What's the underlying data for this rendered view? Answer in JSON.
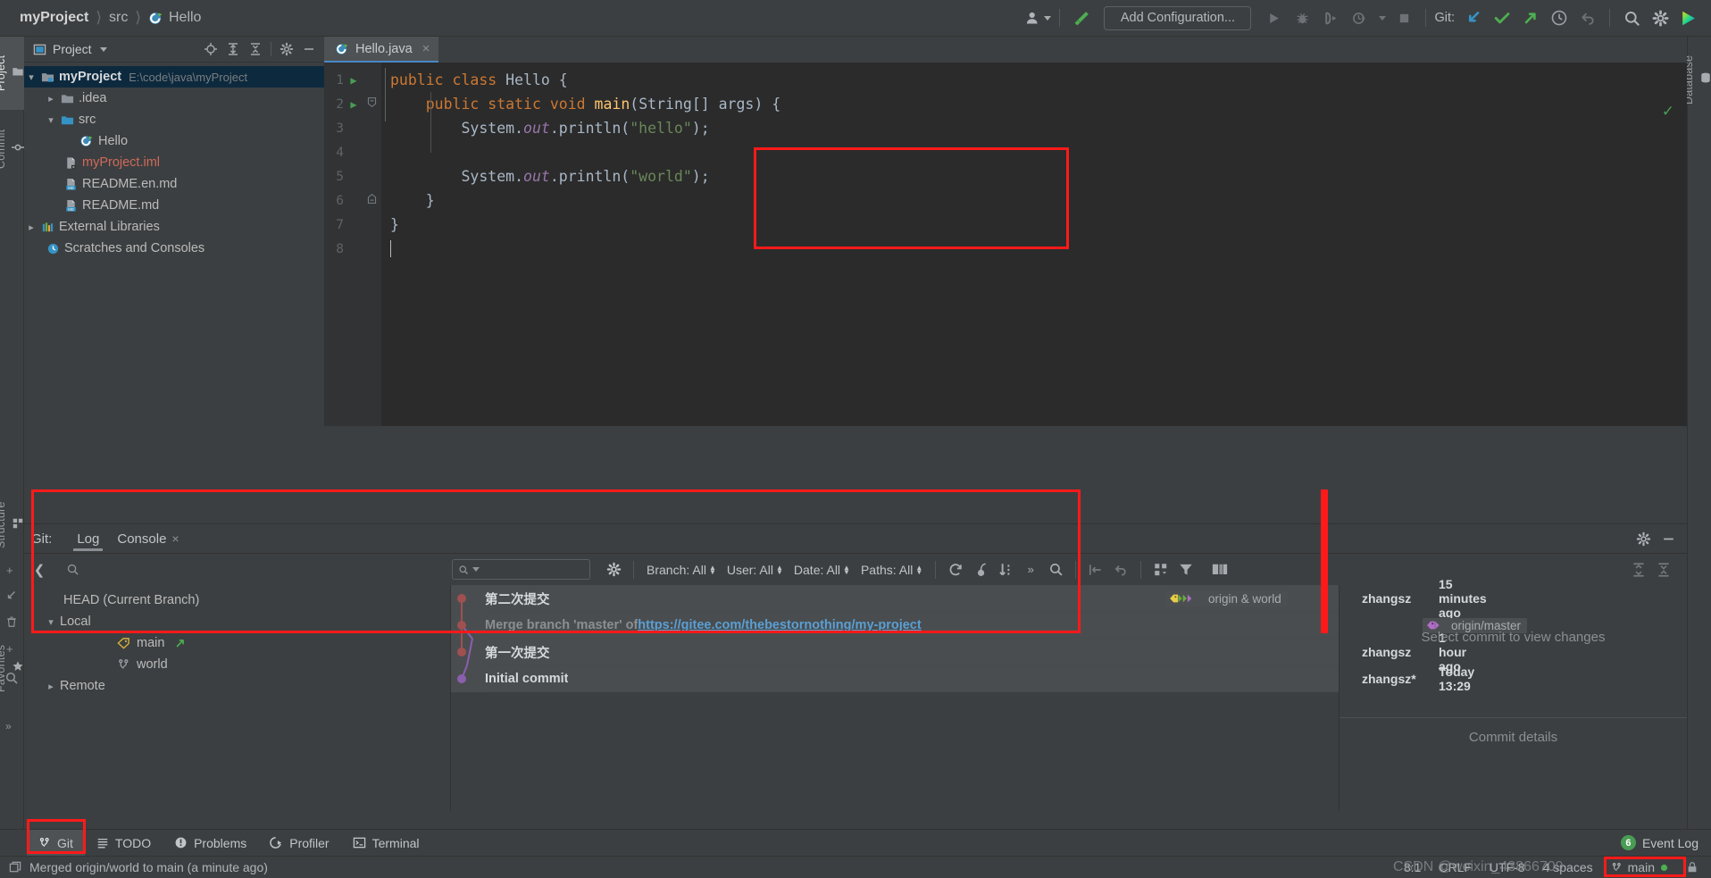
{
  "window": {
    "breadcrumb": [
      "myProject",
      "src",
      "Hello"
    ]
  },
  "toolbar": {
    "profiles_icon": "user-profiles-icon",
    "build_icon": "build-hammer-icon",
    "add_configuration": "Add Configuration...",
    "run_icon": "run-icon",
    "debug_icon": "debug-icon",
    "run_coverage_icon": "run-with-coverage-icon",
    "profile_icon": "profile-dropdown-icon",
    "stop_icon": "stop-icon",
    "git_label": "Git:",
    "git_update_icon": "update-project-icon",
    "git_commit_icon": "commit-checkmark-icon",
    "git_push_icon": "push-arrow-icon",
    "git_history_icon": "history-clock-icon",
    "git_rollback_icon": "rollback-icon",
    "search_icon": "search-everywhere-icon",
    "settings_icon": "gear-icon",
    "ide_logo": "intellij-logo-icon"
  },
  "left_stripe": {
    "tabs": [
      {
        "label": "Project",
        "icon": "folder-icon",
        "selected": true
      },
      {
        "label": "Commit",
        "icon": "commit-icon",
        "selected": false
      },
      {
        "label": "Structure",
        "icon": "structure-icon",
        "selected": false
      },
      {
        "label": "Favorites",
        "icon": "star-icon",
        "selected": false
      }
    ]
  },
  "right_stripe": {
    "tabs": [
      {
        "label": "Database",
        "icon": "database-icon"
      }
    ]
  },
  "project_panel": {
    "title": "Project",
    "header_icons": [
      "locate-icon",
      "expand-all-icon",
      "collapse-all-icon",
      "gear-icon",
      "hide-icon"
    ],
    "tree": [
      {
        "indent": 0,
        "arrow": "v",
        "icon": "module-folder-icon",
        "label": "myProject",
        "sub": "E:\\code\\java\\myProject",
        "bold": true,
        "selected": true
      },
      {
        "indent": 1,
        "arrow": ">",
        "icon": "folder-icon",
        "label": ".idea",
        "sub": ""
      },
      {
        "indent": 1,
        "arrow": "v",
        "icon": "source-folder-icon",
        "label": "src",
        "sub": ""
      },
      {
        "indent": 2,
        "arrow": "",
        "icon": "java-class-icon",
        "label": "Hello",
        "sub": ""
      },
      {
        "indent": 1,
        "arrow": "",
        "icon": "iml-file-icon",
        "label": "myProject.iml",
        "sub": "",
        "color": "red"
      },
      {
        "indent": 1,
        "arrow": "",
        "icon": "markdown-file-icon",
        "label": "README.en.md",
        "sub": ""
      },
      {
        "indent": 1,
        "arrow": "",
        "icon": "markdown-file-icon",
        "label": "README.md",
        "sub": ""
      },
      {
        "indent": 0,
        "arrow": ">",
        "icon": "libraries-icon",
        "label": "External Libraries",
        "sub": ""
      },
      {
        "indent": 0,
        "arrow": "",
        "icon": "scratches-icon",
        "label": "Scratches and Consoles",
        "sub": ""
      }
    ]
  },
  "editor": {
    "tab": {
      "label": "Hello.java",
      "icon": "java-class-icon",
      "close": "×"
    },
    "inspection_status": "ok-checkmark-icon",
    "lines": [
      {
        "num": "1",
        "run": true,
        "fold": "",
        "tokens": [
          {
            "t": "public",
            "c": "kw"
          },
          {
            "t": " ",
            "c": ""
          },
          {
            "t": "class",
            "c": "kw"
          },
          {
            "t": " Hello {",
            "c": "cls"
          }
        ]
      },
      {
        "num": "2",
        "run": true,
        "fold": "open",
        "tokens": [
          {
            "t": "    ",
            "c": ""
          },
          {
            "t": "public",
            "c": "kw"
          },
          {
            "t": " ",
            "c": ""
          },
          {
            "t": "static",
            "c": "kw"
          },
          {
            "t": " ",
            "c": ""
          },
          {
            "t": "void",
            "c": "kw"
          },
          {
            "t": " ",
            "c": ""
          },
          {
            "t": "main",
            "c": "meth"
          },
          {
            "t": "(String[] args) {",
            "c": "cls"
          }
        ]
      },
      {
        "num": "3",
        "run": false,
        "fold": "",
        "tokens": [
          {
            "t": "        System.",
            "c": "cls"
          },
          {
            "t": "out",
            "c": "fld"
          },
          {
            "t": ".println(",
            "c": "cls"
          },
          {
            "t": "\"hello\"",
            "c": "str"
          },
          {
            "t": ");",
            "c": "cls"
          }
        ]
      },
      {
        "num": "4",
        "run": false,
        "fold": "",
        "tokens": []
      },
      {
        "num": "5",
        "run": false,
        "fold": "",
        "tokens": [
          {
            "t": "        System.",
            "c": "cls"
          },
          {
            "t": "out",
            "c": "fld"
          },
          {
            "t": ".println(",
            "c": "cls"
          },
          {
            "t": "\"world\"",
            "c": "str"
          },
          {
            "t": ");",
            "c": "cls"
          }
        ]
      },
      {
        "num": "6",
        "run": false,
        "fold": "close",
        "tokens": [
          {
            "t": "    }",
            "c": "cls"
          }
        ]
      },
      {
        "num": "7",
        "run": false,
        "fold": "",
        "tokens": [
          {
            "t": "}",
            "c": "cls"
          }
        ]
      },
      {
        "num": "8",
        "run": false,
        "fold": "",
        "tokens": [],
        "caret": true
      }
    ]
  },
  "git_panel": {
    "header_label": "Git:",
    "tabs": [
      {
        "label": "Log",
        "active": true,
        "closable": false
      },
      {
        "label": "Console",
        "active": false,
        "closable": true
      }
    ],
    "header_icons": [
      "gear-icon",
      "hide-icon"
    ],
    "toolbar": {
      "back_icon": "back-arrow-icon",
      "search_icon": "search-icon",
      "filter_placeholder": "",
      "filter_search_icon": "search-dropdown-icon",
      "settings_icon": "gear-icon",
      "filters": [
        "Branch: All",
        "User: All",
        "Date: All",
        "Paths: All"
      ],
      "icons": [
        "refresh-icon",
        "cherry-pick-icon",
        "sort-icon",
        "more-chevrons-icon",
        "search-icon"
      ],
      "right_icons": [
        "collapse-to-icon",
        "revert-icon",
        "group-by-icon",
        "filter-funnel-icon",
        "layout-icon",
        "expand-all-icon",
        "collapse-all-icon"
      ]
    },
    "branch_tree": [
      {
        "indent": 1,
        "arrow": "",
        "icon": "",
        "label": "HEAD (Current Branch)"
      },
      {
        "indent": 0,
        "arrow": "v",
        "icon": "",
        "label": "Local"
      },
      {
        "indent": 2,
        "arrow": "",
        "icon": "tag-icon",
        "label": "main",
        "extra_icon": "push-arrow-icon"
      },
      {
        "indent": 2,
        "arrow": "",
        "icon": "branch-icon",
        "label": "world"
      },
      {
        "indent": 0,
        "arrow": ">",
        "icon": "",
        "label": "Remote"
      }
    ],
    "commits": [
      {
        "message": "第二次提交",
        "muted": false,
        "link": "",
        "tags": "origin & world",
        "tag_icons": "tag-and-branch-icons",
        "author": "zhangsz",
        "date": "15 minutes ago",
        "highlight": true,
        "node_color": "#a05050"
      },
      {
        "message": "Merge branch 'master' of ",
        "muted": true,
        "link": "https://gitee.com/thebestornothing/my-project",
        "tags": "origin/master",
        "tag_icons": "tag-icons",
        "author": "",
        "date": "",
        "highlight": true,
        "node_color": "#a05050"
      },
      {
        "message": "第一次提交",
        "muted": false,
        "link": "",
        "tags": "",
        "tag_icons": "",
        "author": "zhangsz",
        "date": "1 hour ago",
        "highlight": true,
        "node_color": "#a05050"
      },
      {
        "message": "Initial commit",
        "muted": false,
        "link": "",
        "tags": "",
        "tag_icons": "",
        "author": "zhangsz*",
        "date": "Today 13:29",
        "highlight": true,
        "node_color": "#8a5fae"
      }
    ],
    "details": {
      "empty_changes": "Select commit to view changes",
      "empty_details": "Commit details"
    }
  },
  "bottom_bar": {
    "items": [
      {
        "label": "Git",
        "icon": "git-branch-icon",
        "selected": true
      },
      {
        "label": "TODO",
        "icon": "todo-list-icon",
        "selected": false
      },
      {
        "label": "Problems",
        "icon": "problems-icon",
        "selected": false
      },
      {
        "label": "Profiler",
        "icon": "profiler-icon",
        "selected": false
      },
      {
        "label": "Terminal",
        "icon": "terminal-icon",
        "selected": false
      }
    ],
    "event_log": {
      "label": "Event Log",
      "count": "6"
    }
  },
  "status_bar": {
    "icon": "memory-icon",
    "message": "Merged origin/world to main (a minute ago)",
    "caret": "8:1",
    "line_sep": "CRLF",
    "encoding": "UTF-8",
    "indent": "4 spaces",
    "branch": "main",
    "lock_icon": "lock-icon",
    "watermark": "CSDN @weixin_43866709"
  }
}
